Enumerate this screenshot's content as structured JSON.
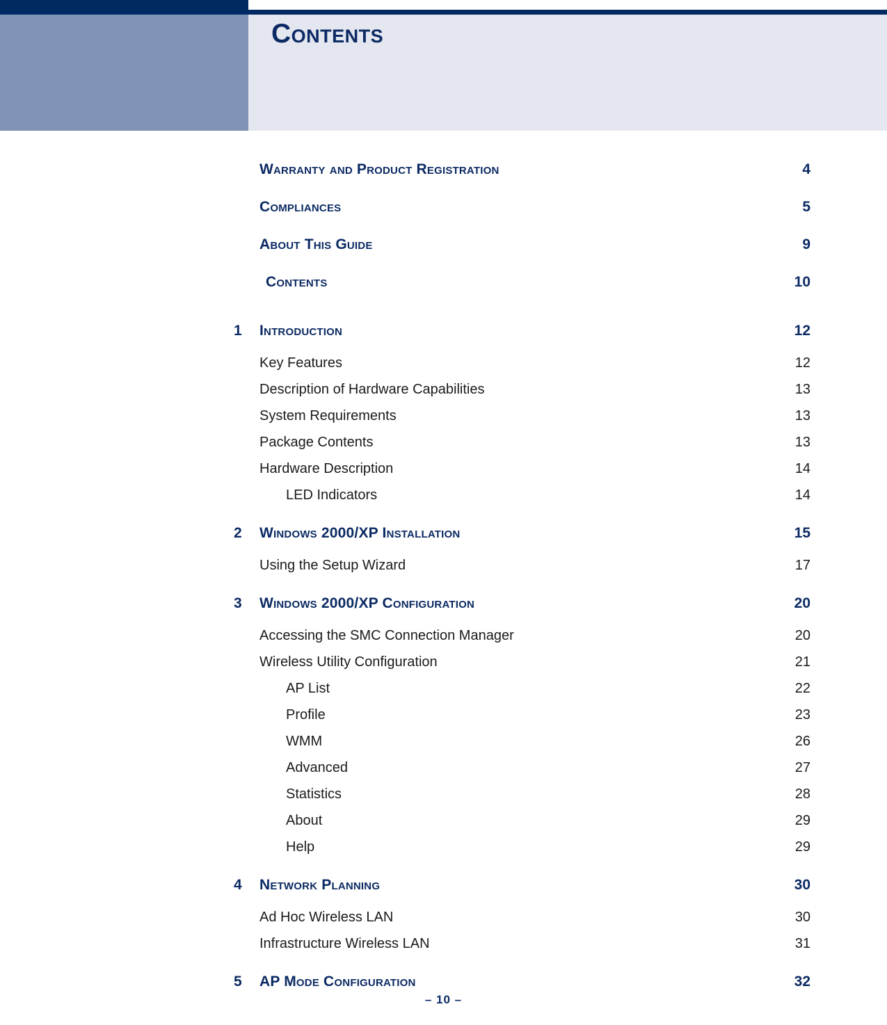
{
  "header": {
    "title": "Contents"
  },
  "toc": {
    "front_matter": [
      {
        "label": "Warranty and Product Registration",
        "page": "4",
        "indent": false
      },
      {
        "label": "Compliances",
        "page": "5",
        "indent": false
      },
      {
        "label": "About This Guide",
        "page": "9",
        "indent": false
      },
      {
        "label": "Contents",
        "page": "10",
        "indent": true
      }
    ],
    "chapters": [
      {
        "number": "1",
        "label": "Introduction",
        "page": "12",
        "entries": [
          {
            "level": 2,
            "label": "Key Features",
            "page": "12"
          },
          {
            "level": 2,
            "label": "Description of Hardware Capabilities",
            "page": "13"
          },
          {
            "level": 2,
            "label": "System Requirements",
            "page": "13"
          },
          {
            "level": 2,
            "label": "Package Contents",
            "page": "13"
          },
          {
            "level": 2,
            "label": "Hardware Description",
            "page": "14"
          },
          {
            "level": 3,
            "label": "LED Indicators",
            "page": "14"
          }
        ]
      },
      {
        "number": "2",
        "label": "Windows 2000/XP Installation",
        "page": "15",
        "entries": [
          {
            "level": 2,
            "label": "Using the Setup Wizard",
            "page": "17"
          }
        ]
      },
      {
        "number": "3",
        "label": "Windows 2000/XP Configuration",
        "page": "20",
        "entries": [
          {
            "level": 2,
            "label": "Accessing the SMC Connection Manager",
            "page": "20"
          },
          {
            "level": 2,
            "label": "Wireless Utility Configuration",
            "page": "21"
          },
          {
            "level": 3,
            "label": "AP List",
            "page": "22"
          },
          {
            "level": 3,
            "label": "Profile",
            "page": "23"
          },
          {
            "level": 3,
            "label": "WMM",
            "page": "26"
          },
          {
            "level": 3,
            "label": "Advanced",
            "page": "27"
          },
          {
            "level": 3,
            "label": "Statistics",
            "page": "28"
          },
          {
            "level": 3,
            "label": "About",
            "page": "29"
          },
          {
            "level": 3,
            "label": "Help",
            "page": "29"
          }
        ]
      },
      {
        "number": "4",
        "label": "Network Planning",
        "page": "30",
        "entries": [
          {
            "level": 2,
            "label": "Ad Hoc Wireless LAN",
            "page": "30"
          },
          {
            "level": 2,
            "label": "Infrastructure Wireless LAN",
            "page": "31"
          }
        ]
      },
      {
        "number": "5",
        "label": "AP Mode Configuration",
        "page": "32",
        "entries": []
      }
    ]
  },
  "footer": {
    "page_marker": "–  10  –"
  }
}
